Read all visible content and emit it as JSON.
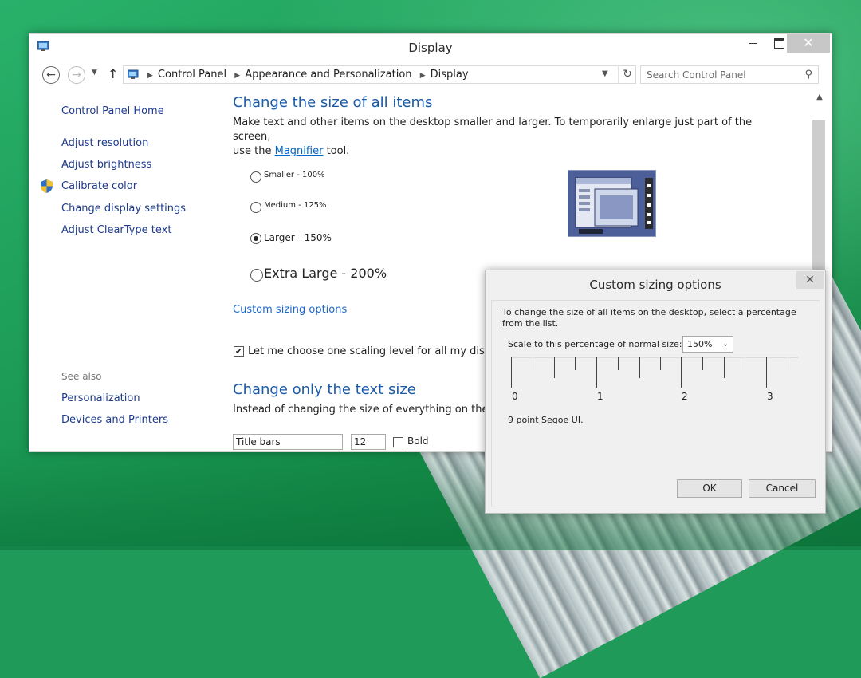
{
  "window": {
    "title": "Display"
  },
  "address_bar": {
    "crumbs": [
      "Control Panel",
      "Appearance and Personalization",
      "Display"
    ],
    "search_placeholder": "Search Control Panel"
  },
  "sidebar": {
    "home": "Control Panel Home",
    "items": [
      "Adjust resolution",
      "Adjust brightness",
      "Calibrate color",
      "Change display settings",
      "Adjust ClearType text"
    ],
    "see_also_label": "See also",
    "see_also": [
      "Personalization",
      "Devices and Printers"
    ]
  },
  "main": {
    "heading1": "Change the size of all items",
    "desc1_part1": "Make text and other items on the desktop smaller and larger. To temporarily enlarge just part of the screen,",
    "desc1_part2": "use the ",
    "desc1_link": "Magnifier",
    "desc1_part3": " tool.",
    "options": [
      {
        "label": "Smaller - 100%",
        "selected": false
      },
      {
        "label": "Medium - 125%",
        "selected": false
      },
      {
        "label": "Larger - 150%",
        "selected": true
      },
      {
        "label": "Extra Large - 200%",
        "selected": false
      }
    ],
    "custom_link": "Custom sizing options",
    "checkbox_label": "Let me choose one scaling level for all my displays",
    "checkbox_checked": true,
    "heading2": "Change only the text size",
    "desc2": "Instead of changing the size of everything on the desk",
    "select_item": "Title bars",
    "select_size": "12",
    "bold_label": "Bold"
  },
  "dialog": {
    "title": "Custom sizing options",
    "text": "To change the size of all items on the desktop, select a percentage from the list.",
    "scale_label": "Scale to this percentage of normal size:",
    "scale_value": "150%",
    "ruler_labels": [
      "0",
      "1",
      "2",
      "3"
    ],
    "font_note": "9 point Segoe UI.",
    "ok": "OK",
    "cancel": "Cancel"
  }
}
